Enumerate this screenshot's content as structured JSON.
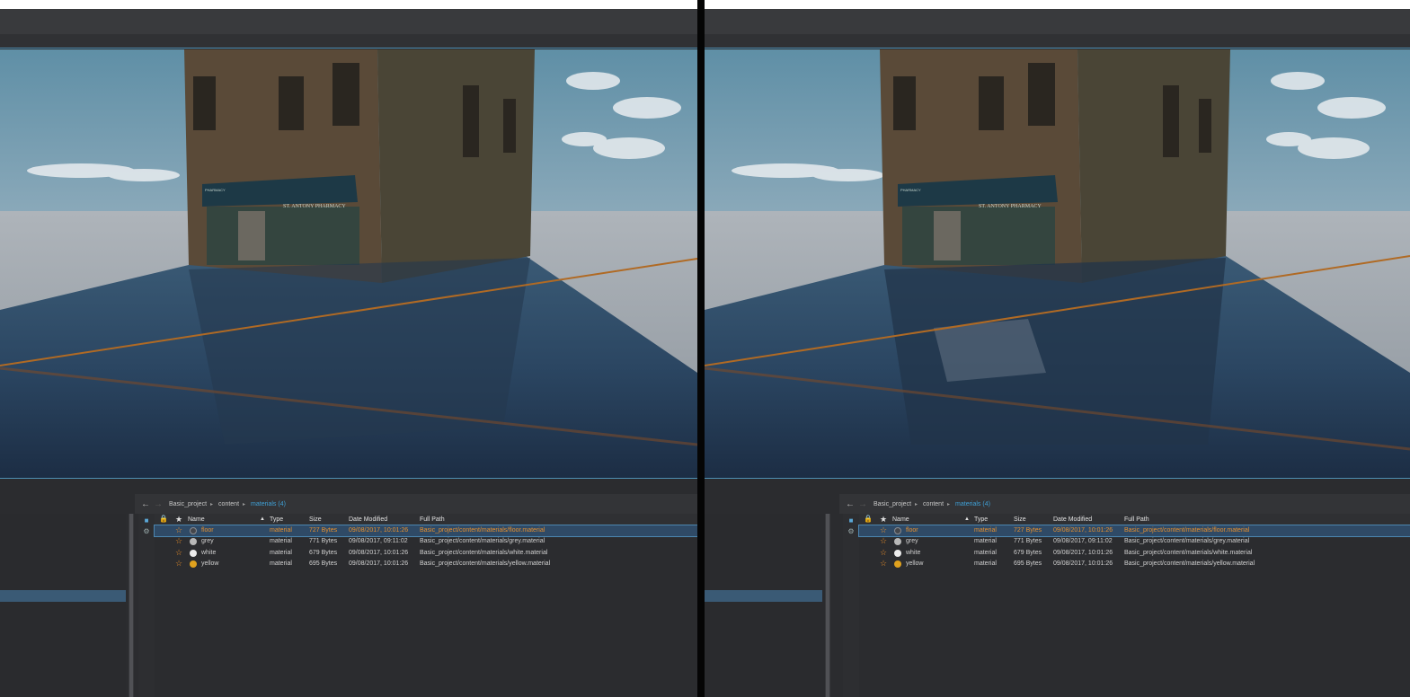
{
  "panes": [
    {
      "id": "left",
      "breadcrumb": [
        {
          "label": "Basic_project",
          "active": false
        },
        {
          "label": "content",
          "active": false
        },
        {
          "label": "materials (4)",
          "active": true
        }
      ],
      "columns": {
        "name": "Name",
        "type": "Type",
        "size": "Size",
        "date": "Date Modified",
        "path": "Full Path"
      },
      "rows": [
        {
          "name": "floor",
          "type": "material",
          "size": "727 Bytes",
          "date": "09/08/2017, 10:01:26",
          "path": "Basic_project/content/materials/floor.material",
          "color": "#44464b",
          "selected": true
        },
        {
          "name": "grey",
          "type": "material",
          "size": "771 Bytes",
          "date": "09/08/2017, 09:11:02",
          "path": "Basic_project/content/materials/grey.material",
          "color": "#b8b8b8",
          "selected": false
        },
        {
          "name": "white",
          "type": "material",
          "size": "679 Bytes",
          "date": "09/08/2017, 10:01:26",
          "path": "Basic_project/content/materials/white.material",
          "color": "#ececec",
          "selected": false
        },
        {
          "name": "yellow",
          "type": "material",
          "size": "695 Bytes",
          "date": "09/08/2017, 10:01:26",
          "path": "Basic_project/content/materials/yellow.material",
          "color": "#e0a21e",
          "selected": false
        }
      ]
    },
    {
      "id": "right",
      "breadcrumb": [
        {
          "label": "Basic_project",
          "active": false
        },
        {
          "label": "content",
          "active": false
        },
        {
          "label": "materials (4)",
          "active": true
        }
      ],
      "columns": {
        "name": "Name",
        "type": "Type",
        "size": "Size",
        "date": "Date Modified",
        "path": "Full Path"
      },
      "rows": [
        {
          "name": "floor",
          "type": "material",
          "size": "727 Bytes",
          "date": "09/08/2017, 10:01:26",
          "path": "Basic_project/content/materials/floor.material",
          "color": "#44464b",
          "selected": true
        },
        {
          "name": "grey",
          "type": "material",
          "size": "771 Bytes",
          "date": "09/08/2017, 09:11:02",
          "path": "Basic_project/content/materials/grey.material",
          "color": "#b8b8b8",
          "selected": false
        },
        {
          "name": "white",
          "type": "material",
          "size": "679 Bytes",
          "date": "09/08/2017, 10:01:26",
          "path": "Basic_project/content/materials/white.material",
          "color": "#ececec",
          "selected": false
        },
        {
          "name": "yellow",
          "type": "material",
          "size": "695 Bytes",
          "date": "09/08/2017, 10:01:26",
          "path": "Basic_project/content/materials/yellow.material",
          "color": "#e0a21e",
          "selected": false
        }
      ]
    }
  ],
  "scene_signs": {
    "store_name": "ST. ANTONY PHARMACY",
    "small_sign": "PHARMACY"
  },
  "icons": {
    "back": "arrow-left-icon",
    "forward": "arrow-right-icon",
    "lock": "lock-icon",
    "favorite": "star-icon",
    "sort": "sort-ascending-icon",
    "folder": "folder-icon",
    "filter": "filter-icon"
  },
  "accent_color": "#e8902e",
  "link_color": "#3fa0d6"
}
